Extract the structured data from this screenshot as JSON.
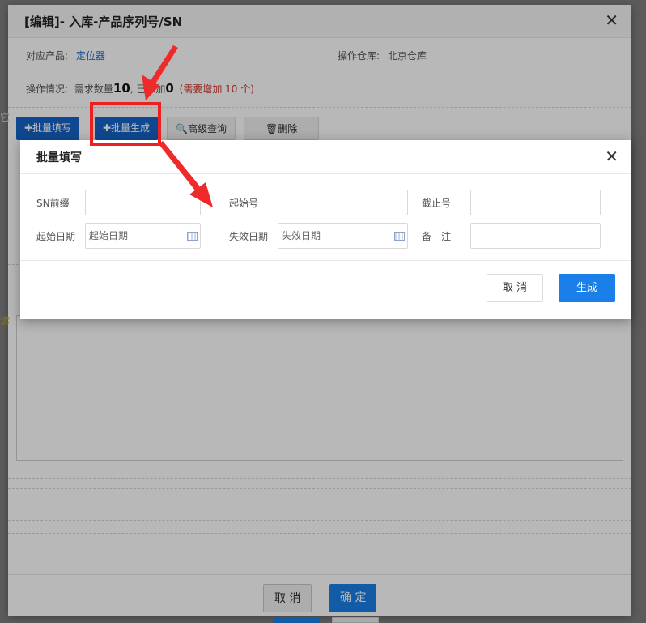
{
  "outer": {
    "title": "[编辑]- 入库-产品序列号/SN",
    "product_label": "对应产品:",
    "product_value": "定位器",
    "warehouse_label": "操作仓库:",
    "warehouse_value": "北京仓库",
    "status_label": "操作情况:",
    "status_demand_prefix": "需求数量",
    "status_demand_value": "10",
    "status_added_prefix": ", 已添加",
    "status_added_value": "0",
    "status_need_text": "(需要增加 10 个)",
    "toolbar": {
      "batch_fill": "✚批量填写",
      "batch_generate": "✚批量生成",
      "advanced_search": "🔍高级查询",
      "delete": "🗑删除"
    },
    "footer": {
      "cancel": "取 消",
      "confirm": "确 定"
    },
    "peek_left_1": "它",
    "peek_left_2": "谚"
  },
  "dialog": {
    "title": "批量填写",
    "fields": {
      "sn_prefix_label": "SN前缀",
      "start_no_label": "起始号",
      "end_no_label": "截止号",
      "start_date_label": "起始日期",
      "start_date_placeholder": "起始日期",
      "expire_date_label": "失效日期",
      "expire_date_placeholder": "失效日期",
      "remark_label": "备　注"
    },
    "cancel": "取 消",
    "generate": "生成"
  },
  "colors": {
    "primary": "#1a7fe8",
    "toolbar_blue": "#1565c8",
    "annotation_red": "#ee1f1f",
    "link_blue": "#1f6fd0",
    "warn_red": "#d0342c"
  }
}
